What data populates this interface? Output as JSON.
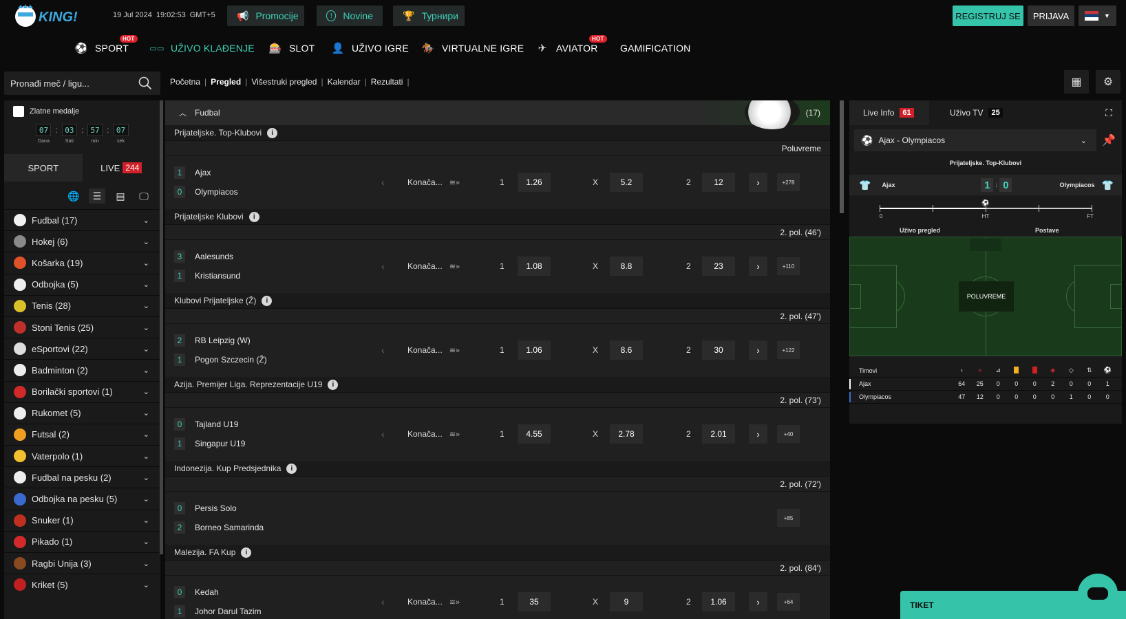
{
  "header": {
    "brand": "KING!",
    "date": "19 Jul 2024",
    "time": "19:02:53",
    "timezone": "GMT+5",
    "pills": [
      "Promocije",
      "Novine",
      "Турнири"
    ],
    "register": "REGISTRUJ SE",
    "login": "PRIJAVA"
  },
  "nav": {
    "hot": "HOT",
    "items": [
      "SPORT",
      "UŽIVO KLAĐENJE",
      "SLOT",
      "UŽIVO IGRE",
      "VIRTUALNE IGRE",
      "AVIATOR",
      "GAMIFICATION"
    ]
  },
  "search": {
    "placeholder": "Pronađi meč / ligu..."
  },
  "medals": {
    "title": "Zlatne medalje",
    "values": [
      "07",
      "03",
      "57",
      "07"
    ],
    "labels": [
      "Dana",
      "Sati",
      "min",
      "sek"
    ]
  },
  "sidebar_tabs": {
    "sport": "SPORT",
    "live": "LIVE",
    "live_count": "244"
  },
  "sports": [
    {
      "label": "Fudbal (17)",
      "color": "#f2f2f2"
    },
    {
      "label": "Hokej (6)",
      "color": "#8a8a8a"
    },
    {
      "label": "Košarka (19)",
      "color": "#e0522a"
    },
    {
      "label": "Odbojka (5)",
      "color": "#eeeeee"
    },
    {
      "label": "Tenis (28)",
      "color": "#d8c02a"
    },
    {
      "label": "Stoni Tenis (25)",
      "color": "#c0302a"
    },
    {
      "label": "eSportovi (22)",
      "color": "#dddddd"
    },
    {
      "label": "Badminton (2)",
      "color": "#eeeeee"
    },
    {
      "label": "Borilački sportovi (1)",
      "color": "#d02a2a"
    },
    {
      "label": "Rukomet (5)",
      "color": "#eeeeee"
    },
    {
      "label": "Futsal (2)",
      "color": "#f0a020"
    },
    {
      "label": "Vaterpolo (1)",
      "color": "#f0c030"
    },
    {
      "label": "Fudbal na pesku (2)",
      "color": "#eeeeee"
    },
    {
      "label": "Odbojka na pesku (5)",
      "color": "#3a6ad0"
    },
    {
      "label": "Snuker (1)",
      "color": "#c03020"
    },
    {
      "label": "Pikado (1)",
      "color": "#d02a2a"
    },
    {
      "label": "Ragbi Unija (3)",
      "color": "#8a4a20"
    },
    {
      "label": "Kriket (5)",
      "color": "#c02020"
    }
  ],
  "breadcrumb": [
    "Početna",
    "Pregled",
    "Višestruki pregled",
    "Kalendar",
    "Rezultati"
  ],
  "section": {
    "title": "Fudbal",
    "count": "(17)"
  },
  "market_label": "Konača...",
  "outcome_labels": [
    "1",
    "X",
    "2"
  ],
  "leagues": [
    {
      "name": "Prijateljske. Top-Klubovi",
      "period": "Poluvreme",
      "home": "Ajax",
      "home_score": "1",
      "away": "Olympiacos",
      "away_score": "0",
      "odds": [
        "1.26",
        "5.2",
        "12"
      ],
      "more": "+278",
      "has_odds": true
    },
    {
      "name": "Prijateljske Klubovi",
      "period": "2. pol.  (46')",
      "home": "Aalesunds",
      "home_score": "3",
      "away": "Kristiansund",
      "away_score": "1",
      "odds": [
        "1.08",
        "8.8",
        "23"
      ],
      "more": "+110",
      "has_odds": true
    },
    {
      "name": "Klubovi Prijateljske (Ž)",
      "period": "2. pol.  (47')",
      "home": "RB Leipzig (W)",
      "home_score": "2",
      "away": "Pogon Szczecin (Ž)",
      "away_score": "1",
      "odds": [
        "1.06",
        "8.6",
        "30"
      ],
      "more": "+122",
      "has_odds": true
    },
    {
      "name": "Azija. Premijer Liga. Reprezentacije U19",
      "period": "2. pol.  (73')",
      "home": "Tajland U19",
      "home_score": "0",
      "away": "Singapur U19",
      "away_score": "1",
      "odds": [
        "4.55",
        "2.78",
        "2.01"
      ],
      "more": "+40",
      "has_odds": true
    },
    {
      "name": "Indonezija. Kup Predsjednika",
      "period": "2. pol.  (72')",
      "home": "Persis Solo",
      "home_score": "0",
      "away": "Borneo Samarinda",
      "away_score": "2",
      "odds": [],
      "more": "+85",
      "has_odds": false
    },
    {
      "name": "Malezija. FA Kup",
      "period": "2. pol.  (84')",
      "home": "Kedah",
      "home_score": "0",
      "away": "Johor Darul Tazim",
      "away_score": "1",
      "odds": [
        "35",
        "9",
        "1.06"
      ],
      "more": "+64",
      "has_odds": true
    }
  ],
  "right": {
    "live_info": "Live Info",
    "live_info_count": "61",
    "live_tv": "Uživo TV",
    "live_tv_count": "25",
    "match": "Ajax - Olympiacos",
    "competition": "Prijateljske. Top-Klubovi",
    "home": "Ajax",
    "away": "Olympiacos",
    "home_score": "1",
    "away_score": "0",
    "timeline": [
      "0",
      "HT",
      "FT"
    ],
    "sub_tabs": [
      "Uživo pregled",
      "Postave"
    ],
    "pitch_status": "POLUVREME",
    "stats_header": "Timovi",
    "stats": [
      {
        "team": "Ajax",
        "values": [
          "64",
          "25",
          "0",
          "0",
          "0",
          "2",
          "0",
          "0",
          "1"
        ],
        "color": "#ffffff"
      },
      {
        "team": "Olympiacos",
        "values": [
          "47",
          "12",
          "0",
          "0",
          "0",
          "0",
          "1",
          "0",
          "0"
        ],
        "color": "#3a6ad0"
      }
    ]
  },
  "tiket": "TIKET"
}
